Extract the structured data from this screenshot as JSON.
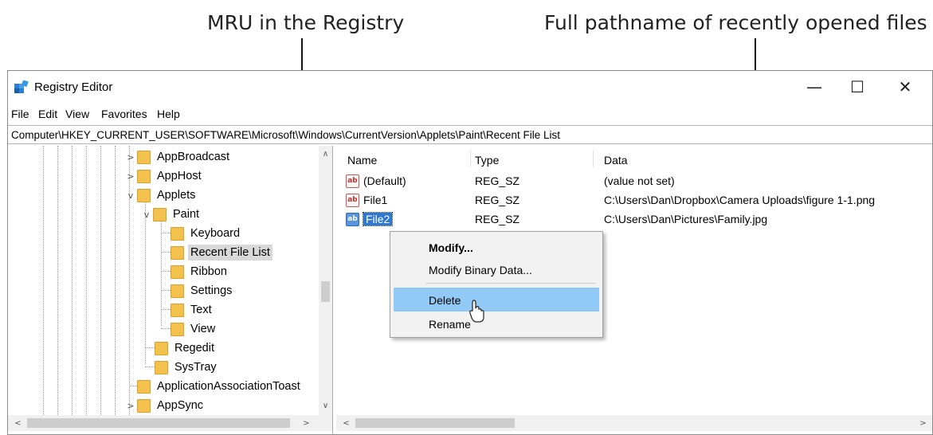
{
  "callouts": {
    "left": "MRU in the Registry",
    "right": "Full pathname of recently opened files"
  },
  "window": {
    "title": "Registry Editor",
    "app_icon": "registry-editor-icon",
    "controls": {
      "minimize": "—",
      "maximize": "☐",
      "close": "✕"
    }
  },
  "menu": [
    "File",
    "Edit",
    "View",
    "Favorites",
    "Help"
  ],
  "address": "Computer\\HKEY_CURRENT_USER\\SOFTWARE\\Microsoft\\Windows\\CurrentVersion\\Applets\\Paint\\Recent File List",
  "tree": {
    "nodes": [
      {
        "label": "AppBroadcast",
        "expander": ">",
        "depth": 0
      },
      {
        "label": "AppHost",
        "expander": ">",
        "depth": 0
      },
      {
        "label": "Applets",
        "expander": "v",
        "depth": 0
      },
      {
        "label": "Paint",
        "expander": "v",
        "depth": 1
      },
      {
        "label": "Keyboard",
        "expander": "",
        "depth": 2
      },
      {
        "label": "Recent File List",
        "expander": "",
        "depth": 2,
        "selected": true
      },
      {
        "label": "Ribbon",
        "expander": "",
        "depth": 2
      },
      {
        "label": "Settings",
        "expander": "",
        "depth": 2
      },
      {
        "label": "Text",
        "expander": "",
        "depth": 2
      },
      {
        "label": "View",
        "expander": "",
        "depth": 2
      },
      {
        "label": "Regedit",
        "expander": "",
        "depth": 1
      },
      {
        "label": "SysTray",
        "expander": "",
        "depth": 1
      },
      {
        "label": "ApplicationAssociationToast",
        "expander": "",
        "depth": 0
      },
      {
        "label": "AppSync",
        "expander": ">",
        "depth": 0
      }
    ],
    "scroll": {
      "up": "∧",
      "down": "∨",
      "left": "<",
      "right": ">"
    }
  },
  "values": {
    "columns": [
      "Name",
      "Type",
      "Data"
    ],
    "rows": [
      {
        "icon": "ab",
        "name": "(Default)",
        "type": "REG_SZ",
        "data": "(value not set)"
      },
      {
        "icon": "ab",
        "name": "File1",
        "type": "REG_SZ",
        "data": "C:\\Users\\Dan\\Dropbox\\Camera Uploads\\figure 1-1.png"
      },
      {
        "icon": "ab",
        "name": "File2",
        "type": "REG_SZ",
        "data": "C:\\Users\\Dan\\Pictures\\Family.jpg",
        "selected": true
      }
    ],
    "scroll": {
      "left": "<",
      "right": ">"
    }
  },
  "context_menu": {
    "items": [
      "Modify...",
      "Modify Binary Data...",
      "Delete",
      "Rename"
    ],
    "default_item": "Modify...",
    "hover_item": "Delete"
  },
  "colors": {
    "selection": "#2e78d0",
    "menu_hover": "#91c9f7",
    "folder": "#f2c14e"
  }
}
